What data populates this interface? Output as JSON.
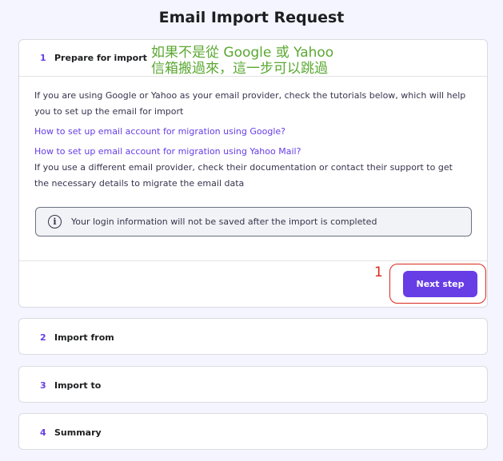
{
  "page": {
    "title": "Email Import Request"
  },
  "steps": [
    {
      "num": "1",
      "label": "Prepare for import"
    },
    {
      "num": "2",
      "label": "Import from"
    },
    {
      "num": "3",
      "label": "Import to"
    },
    {
      "num": "4",
      "label": "Summary"
    }
  ],
  "prepare": {
    "intro": "If you are using Google or Yahoo as your email provider, check the tutorials below, which will help you to set up the email for import",
    "link_google": "How to set up email account for migration using Google?",
    "link_yahoo": "How to set up email account for migration using Yahoo Mail?",
    "other_provider": "If you use a different email provider, check their documentation or contact their support to get the necessary details to migrate the email data",
    "info_icon": "i",
    "info_text": "Your login information will not be saved after the import is completed",
    "next_label": "Next step"
  },
  "annotations": {
    "note_line1": "如果不是從 Google 或 Yahoo",
    "note_line2": "信箱搬過來，這一步可以跳過",
    "marker_number": "1"
  },
  "colors": {
    "accent": "#673de6",
    "annotation_red": "#d9281c",
    "annotation_green": "#5aa832",
    "background": "#f4f5ff"
  }
}
